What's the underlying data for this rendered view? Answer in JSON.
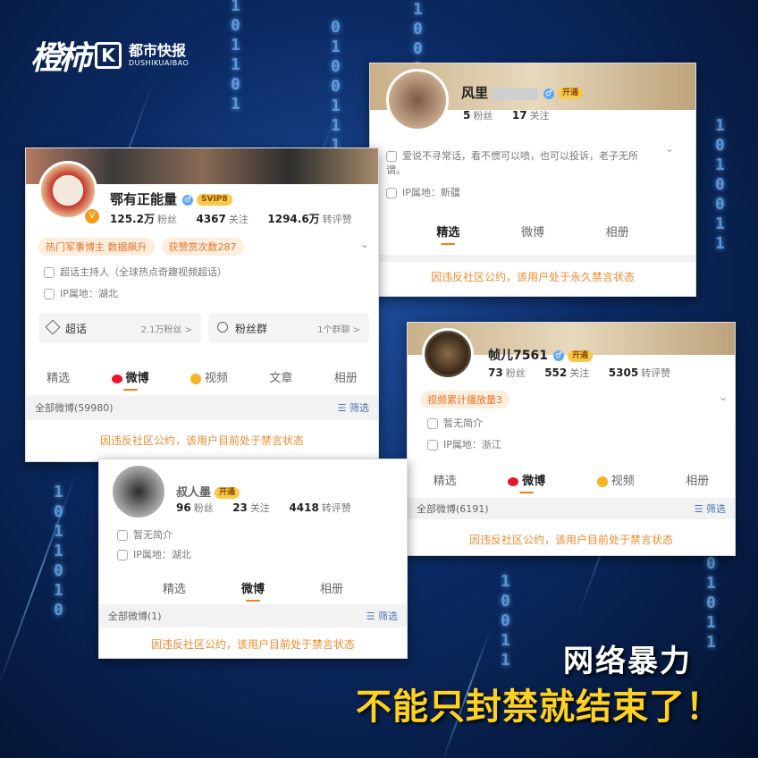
{
  "logo": {
    "script": "橙柿",
    "k": "K",
    "cn": "都市快报",
    "en": "DUSHIKUAIBAO"
  },
  "card_top": {
    "name": "风里",
    "vip": "开通",
    "fans_num": "5",
    "fans_label": "粉丝",
    "follow_num": "17",
    "follow_label": "关注",
    "bio": "爱说不寻常话，看不惯可以喷，也可以投诉，老子无所谓。",
    "ip": "IP属地：新疆",
    "tabs": [
      "精选",
      "微博",
      "相册"
    ],
    "banned": "因违反社区公约，该用户处于永久禁言状态"
  },
  "card_main": {
    "name": "鄂有正能量",
    "vip": "SVIP8",
    "fans_num": "125.2万",
    "fans_label": "粉丝",
    "follow_num": "4367",
    "follow_label": "关注",
    "likes_num": "1294.6万",
    "likes_label": "转评赞",
    "tags": [
      "热门军事博主 数据飙升",
      "获赞赏次数287"
    ],
    "host": "超话主持人（全球热点奇趣视频超话）",
    "ip": "IP属地：湖北",
    "chaohua": "超话",
    "chaohua_right": "2.1万粉丝 >",
    "fans_group": "粉丝群",
    "fans_group_right": "1个群聊 >",
    "tabs": [
      "精选",
      "微博",
      "视频",
      "文章",
      "相册"
    ],
    "all_weibo": "全部微博(59980)",
    "filter": "筛选",
    "banned": "因违反社区公约，该用户目前处于禁言状态"
  },
  "card_right": {
    "name": "帧儿7561",
    "vip": "开通",
    "fans_num": "73",
    "fans_label": "粉丝",
    "follow_num": "552",
    "follow_label": "关注",
    "likes_num": "5305",
    "likes_label": "转评赞",
    "tag": "视频累计播放量3",
    "bio": "暂无简介",
    "ip": "IP属地：浙江",
    "tabs": [
      "精选",
      "微博",
      "视频",
      "相册"
    ],
    "all_weibo": "全部微博(6191)",
    "filter": "筛选",
    "banned": "因违反社区公约，该用户目前处于禁言状态"
  },
  "card_bottom": {
    "name": "叔人墨",
    "vip": "开通",
    "fans_num": "96",
    "fans_label": "粉丝",
    "follow_num": "23",
    "follow_label": "关注",
    "likes_num": "4418",
    "likes_label": "转评赞",
    "bio": "暂无简介",
    "ip": "IP属地：湖北",
    "tabs": [
      "精选",
      "微博",
      "相册"
    ],
    "all_weibo": "全部微博(1)",
    "filter": "筛选",
    "banned": "因违反社区公约，该用户目前处于禁言状态"
  },
  "headline1": "网络暴力",
  "headline2": "不能只封禁就结束了！",
  "colors": {
    "accent": "#f08a2e",
    "headline_yellow": "#ffd21f",
    "bg_dark": "#04122e"
  }
}
